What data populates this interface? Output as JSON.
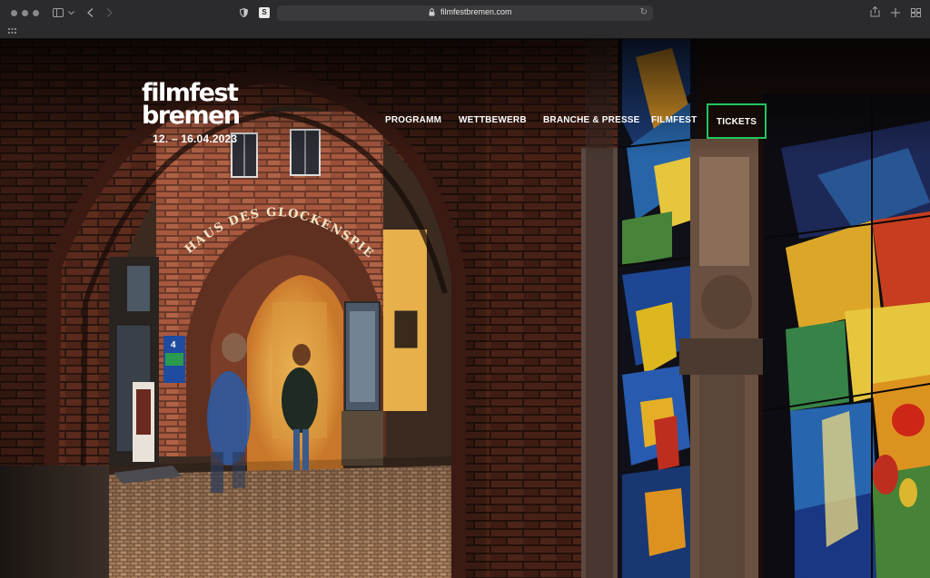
{
  "browser": {
    "url": "filmfestbremen.com",
    "icons": [
      "sidebar-icon",
      "chevron-down-icon",
      "back-icon",
      "forward-icon",
      "shield-icon",
      "site-favicon",
      "lock-icon",
      "reload-icon",
      "share-icon",
      "new-tab-icon",
      "tab-overview-icon",
      "grid-icon"
    ]
  },
  "site": {
    "logo_line1": "filmfest",
    "logo_line2": "bremen",
    "dates": "12. – 16.04.2023",
    "nav": [
      {
        "label": "PROGRAMM"
      },
      {
        "label": "WETTBEWERB"
      },
      {
        "label": "BRANCHE & PRESSE"
      },
      {
        "label": "FILMFEST"
      },
      {
        "label": "TICKETS"
      }
    ],
    "hero": {
      "sign_text": "HAUS DES GLOCKENSPIELS",
      "number_sign": "4"
    },
    "colors": {
      "accent": "#22c55e",
      "nav_text": "#ffffff"
    }
  }
}
